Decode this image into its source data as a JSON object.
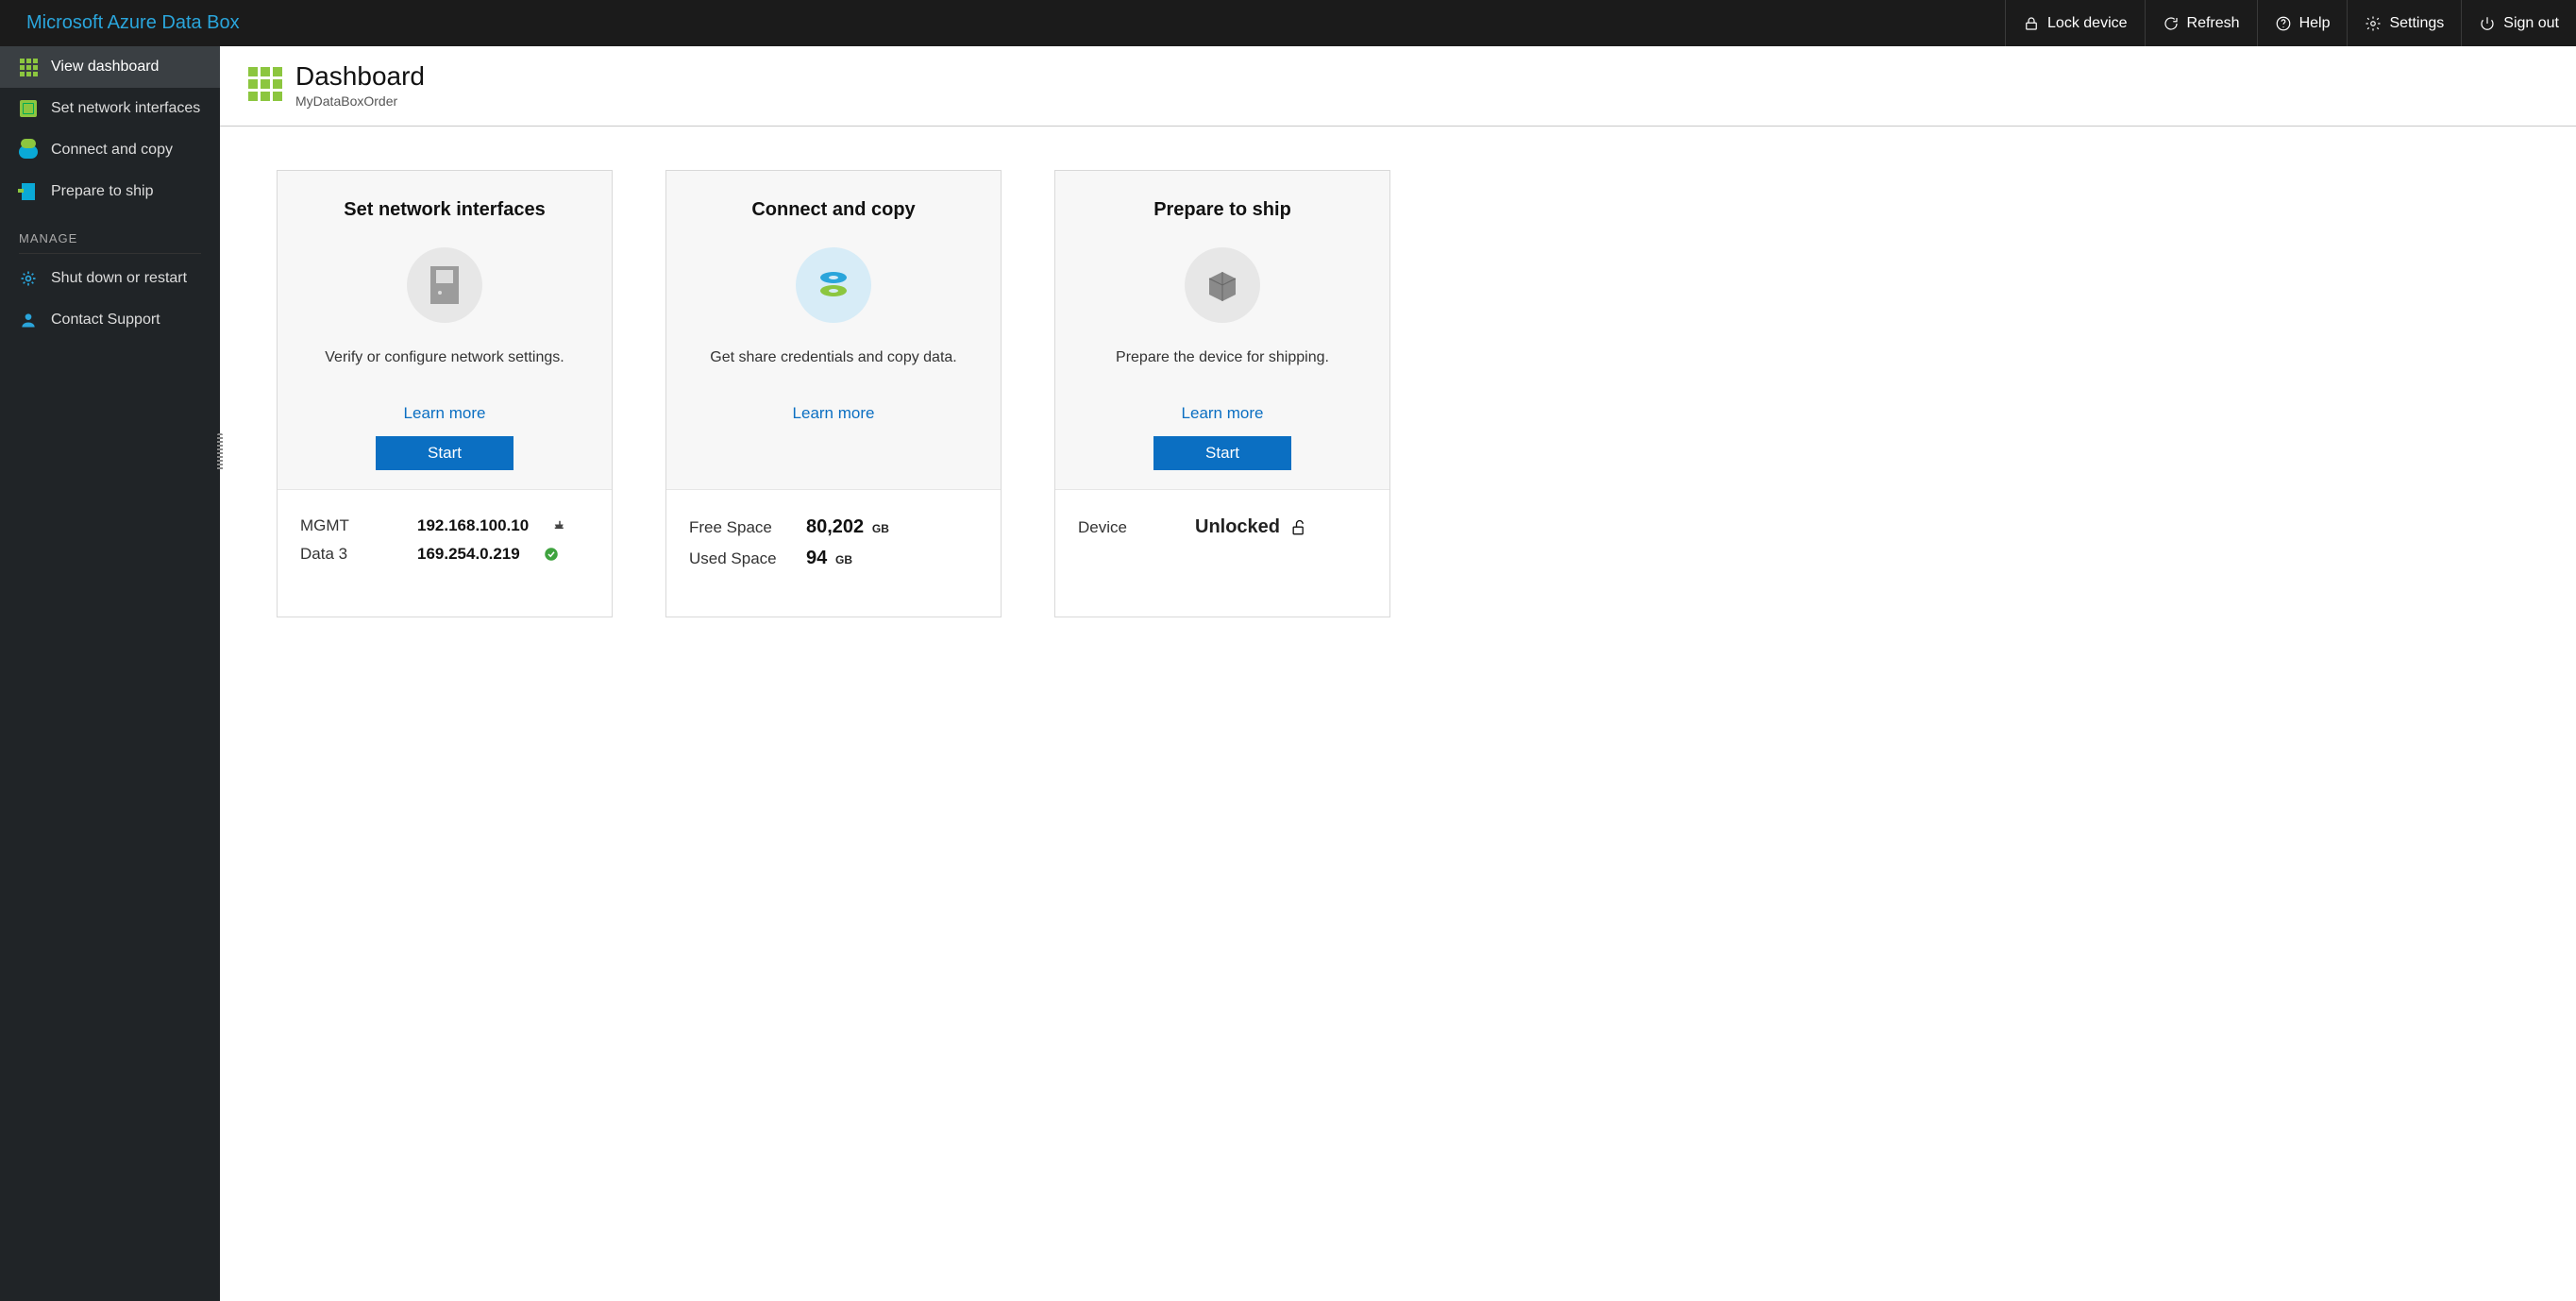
{
  "brand": "Microsoft Azure Data Box",
  "top": {
    "lock": "Lock device",
    "refresh": "Refresh",
    "help": "Help",
    "settings": "Settings",
    "signout": "Sign out"
  },
  "sidebar": {
    "items": [
      {
        "label": "View dashboard"
      },
      {
        "label": "Set network interfaces"
      },
      {
        "label": "Connect and copy"
      },
      {
        "label": "Prepare to ship"
      }
    ],
    "section": "MANAGE",
    "manage": [
      {
        "label": "Shut down or restart"
      },
      {
        "label": "Contact Support"
      }
    ]
  },
  "page": {
    "title": "Dashboard",
    "subtitle": "MyDataBoxOrder"
  },
  "cards": {
    "net": {
      "title": "Set network interfaces",
      "desc": "Verify or configure network settings.",
      "learn": "Learn more",
      "start": "Start",
      "rows": [
        {
          "k": "MGMT",
          "v": "192.168.100.10",
          "icon": "plug"
        },
        {
          "k": "Data 3",
          "v": "169.254.0.219",
          "icon": "check"
        }
      ]
    },
    "copy": {
      "title": "Connect and copy",
      "desc": "Get share credentials and copy data.",
      "learn": "Learn more",
      "rows": [
        {
          "k": "Free Space",
          "v": "80,202",
          "unit": "GB"
        },
        {
          "k": "Used Space",
          "v": "94",
          "unit": "GB"
        }
      ]
    },
    "ship": {
      "title": "Prepare to ship",
      "desc": "Prepare the device for shipping.",
      "learn": "Learn more",
      "start": "Start",
      "device_label": "Device",
      "device_status": "Unlocked"
    }
  }
}
